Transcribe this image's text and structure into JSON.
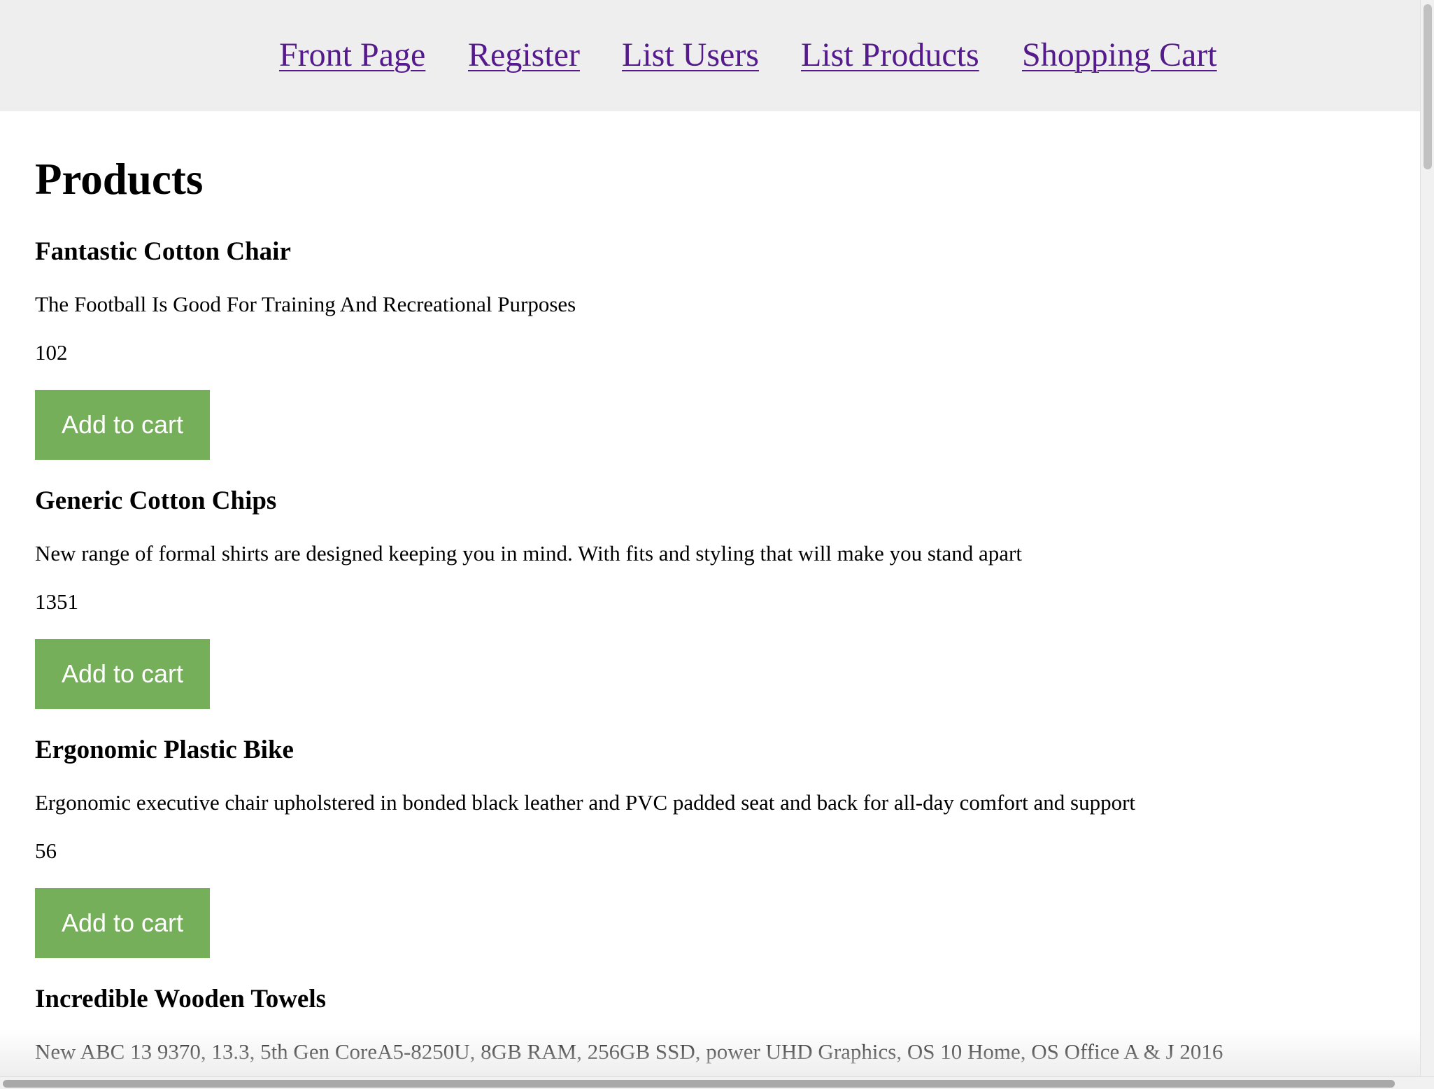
{
  "nav": {
    "items": [
      {
        "label": "Front Page"
      },
      {
        "label": "Register"
      },
      {
        "label": "List Users"
      },
      {
        "label": "List Products"
      },
      {
        "label": "Shopping Cart"
      }
    ]
  },
  "page": {
    "title": "Products"
  },
  "products": [
    {
      "name": "Fantastic Cotton Chair",
      "description": "The Football Is Good For Training And Recreational Purposes",
      "price": "102",
      "button_label": "Add to cart"
    },
    {
      "name": "Generic Cotton Chips",
      "description": "New range of formal shirts are designed keeping you in mind. With fits and styling that will make you stand apart",
      "price": "1351",
      "button_label": "Add to cart"
    },
    {
      "name": "Ergonomic Plastic Bike",
      "description": "Ergonomic executive chair upholstered in bonded black leather and PVC padded seat and back for all-day comfort and support",
      "price": "56",
      "button_label": "Add to cart"
    },
    {
      "name": "Incredible Wooden Towels",
      "description": "New ABC 13 9370, 13.3, 5th Gen CoreA5-8250U, 8GB RAM, 256GB SSD, power UHD Graphics, OS 10 Home, OS Office A & J 2016"
    }
  ],
  "colors": {
    "nav_background": "#eeeeee",
    "link": "#551a8b",
    "button": "#76af5a",
    "button_text": "#ffffff"
  }
}
